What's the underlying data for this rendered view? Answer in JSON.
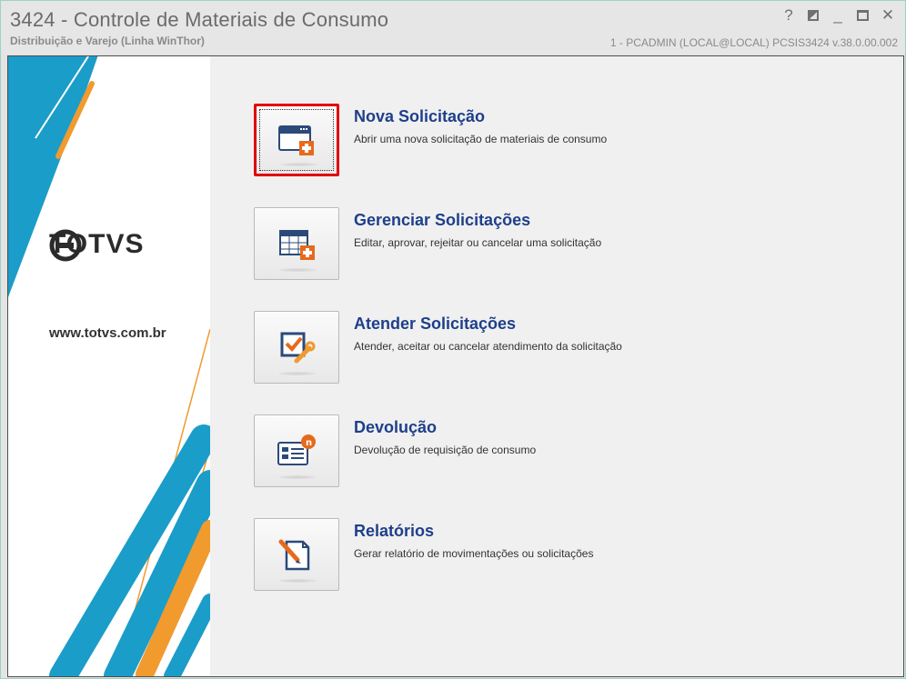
{
  "window": {
    "title": "3424 - Controle de Materiais de Consumo",
    "subtitle": "Distribuição e Varejo (Linha WinThor)",
    "session": "1 - PCADMIN (LOCAL@LOCAL)   PCSIS3424   v.38.0.00.002",
    "controls": {
      "help": "?",
      "minimize": "_",
      "close": "✕"
    }
  },
  "brand": {
    "name": "TOTVS",
    "url": "www.totvs.com.br"
  },
  "menu": [
    {
      "title": "Nova Solicitação",
      "description": "Abrir uma nova solicitação de materiais de consumo",
      "icon": "new-request-icon",
      "selected": true
    },
    {
      "title": "Gerenciar Solicitações",
      "description": "Editar, aprovar, rejeitar ou cancelar uma solicitação",
      "icon": "manage-requests-icon",
      "selected": false
    },
    {
      "title": "Atender Solicitações",
      "description": "Atender, aceitar ou cancelar atendimento da solicitação",
      "icon": "fulfill-requests-icon",
      "selected": false
    },
    {
      "title": "Devolução",
      "description": "Devolução de requisição de consumo",
      "icon": "return-icon",
      "selected": false
    },
    {
      "title": "Relatórios",
      "description": "Gerar relatório de movimentações ou solicitações",
      "icon": "reports-icon",
      "selected": false
    }
  ],
  "colors": {
    "accent_blue": "#1e3f8a",
    "brand_cyan": "#1a9dc8",
    "brand_orange": "#f19a2e",
    "selection_red": "#e10000"
  }
}
